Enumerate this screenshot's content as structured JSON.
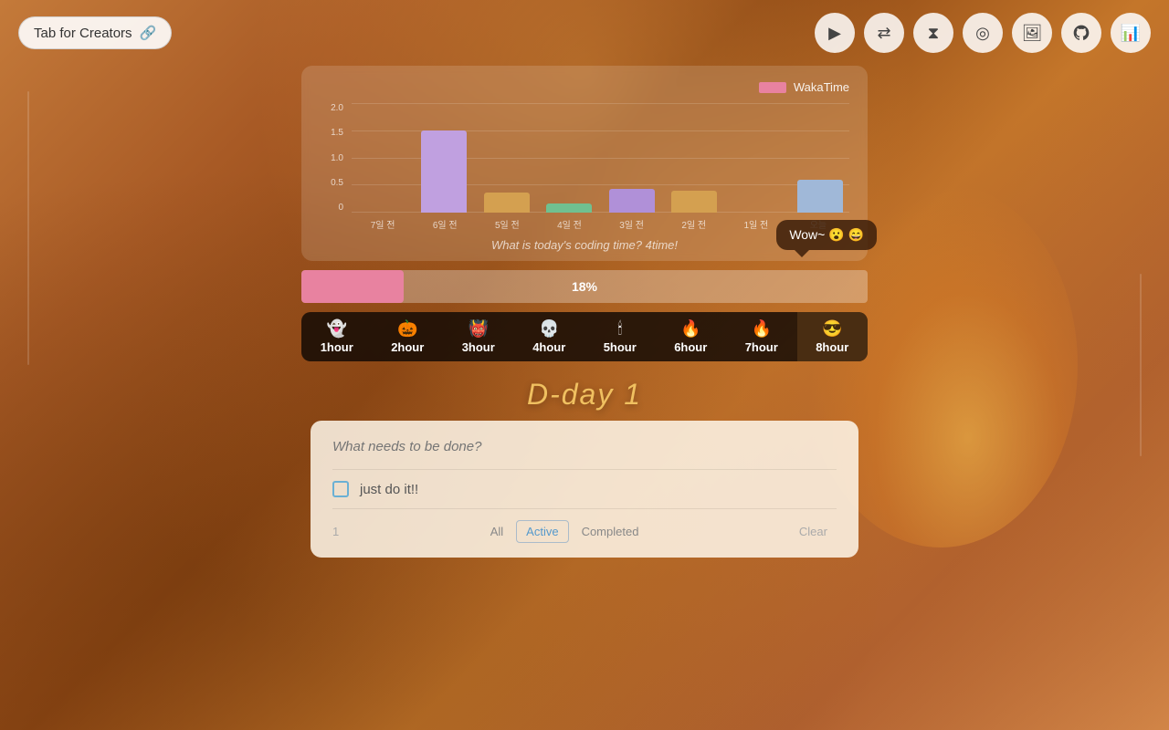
{
  "brand": {
    "label": "Tab for Creators",
    "emoji": "🔗"
  },
  "nav": {
    "icons": [
      {
        "name": "play-icon",
        "symbol": "▶"
      },
      {
        "name": "shuffle-icon",
        "symbol": "⇄"
      },
      {
        "name": "timer-icon",
        "symbol": "⧗"
      },
      {
        "name": "target-icon",
        "symbol": "◎"
      },
      {
        "name": "image-icon",
        "symbol": "🖼"
      },
      {
        "name": "github-icon",
        "symbol": "⊙"
      },
      {
        "name": "chart-icon",
        "symbol": "📈"
      }
    ]
  },
  "chart": {
    "legend_label": "WakaTime",
    "subtitle": "What is today's coding time? 4time!",
    "y_labels": [
      "2.0",
      "1.5",
      "1.0",
      "0.5",
      "0"
    ],
    "x_labels": [
      "7일 전",
      "6일 전",
      "5일 전",
      "4일 전",
      "3일 전",
      "2일 전",
      "1일 전",
      "오늘"
    ],
    "bars": [
      {
        "height_pct": 0,
        "color": "#a888d0"
      },
      {
        "height_pct": 75,
        "color": "#c0a0e0"
      },
      {
        "height_pct": 18,
        "color": "#d4a050"
      },
      {
        "height_pct": 8,
        "color": "#70c090"
      },
      {
        "height_pct": 22,
        "color": "#b090d8"
      },
      {
        "height_pct": 20,
        "color": "#d4a050"
      },
      {
        "height_pct": 0,
        "color": "#a888d0"
      },
      {
        "height_pct": 30,
        "color": "#a0b8d8"
      }
    ]
  },
  "progress": {
    "value": 18,
    "label": "18%",
    "wow_text": "Wow~ 😮 😄"
  },
  "hour_tabs": [
    {
      "emoji": "👻",
      "label": "1hour",
      "active": false
    },
    {
      "emoji": "🎃",
      "label": "2hour",
      "active": false
    },
    {
      "emoji": "👹",
      "label": "3hour",
      "active": false
    },
    {
      "emoji": "💀",
      "label": "4hour",
      "active": false
    },
    {
      "emoji": "🕯",
      "label": "5hour",
      "active": false
    },
    {
      "emoji": "🔥",
      "label": "6hour",
      "active": false
    },
    {
      "emoji": "🔥",
      "label": "7hour",
      "active": false
    },
    {
      "emoji": "😎",
      "label": "8hour",
      "active": true
    }
  ],
  "dday": {
    "label": "D-day 1"
  },
  "todo": {
    "placeholder": "What needs to be done?",
    "items": [
      {
        "id": 1,
        "text": "just do it!!",
        "completed": false
      }
    ],
    "count_label": "1",
    "filters": [
      {
        "label": "All",
        "active": false
      },
      {
        "label": "Active",
        "active": true
      },
      {
        "label": "Completed",
        "active": false
      }
    ],
    "clear_label": "Clear"
  }
}
